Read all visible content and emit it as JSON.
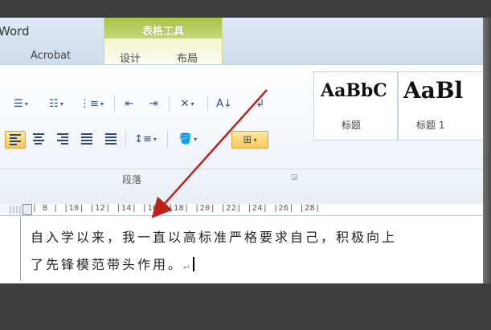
{
  "window": {
    "app_title": "Word",
    "context_tab_header": "表格工具",
    "tabs": [
      "Acrobat",
      "设计",
      "布局"
    ]
  },
  "ribbon": {
    "paragraph_group_label": "段落",
    "row1_buttons": [
      {
        "name": "bullets-button",
        "icon": "bullets-icon"
      },
      {
        "name": "numbering-button",
        "icon": "numbering-icon"
      },
      {
        "name": "multilevel-list-button",
        "icon": "multilevel-list-icon"
      },
      {
        "name": "decrease-indent-button",
        "icon": "decrease-indent-icon"
      },
      {
        "name": "increase-indent-button",
        "icon": "increase-indent-icon"
      },
      {
        "name": "chinese-layout-button",
        "icon": "chinese-layout-icon"
      },
      {
        "name": "sort-button",
        "icon": "sort-az-icon"
      },
      {
        "name": "show-marks-button",
        "icon": "pilcrow-icon"
      }
    ],
    "row2_buttons": [
      {
        "name": "align-left-button",
        "icon": "align-left-icon",
        "active": true
      },
      {
        "name": "align-center-button",
        "icon": "align-center-icon"
      },
      {
        "name": "align-right-button",
        "icon": "align-right-icon"
      },
      {
        "name": "justify-button",
        "icon": "justify-icon"
      },
      {
        "name": "distributed-button",
        "icon": "distributed-icon"
      },
      {
        "name": "line-spacing-button",
        "icon": "line-spacing-icon"
      },
      {
        "name": "shading-button",
        "icon": "shading-bucket-icon"
      },
      {
        "name": "borders-button",
        "icon": "borders-icon",
        "active": true
      }
    ],
    "styles": [
      {
        "preview": "AaBbC",
        "label": "标题"
      },
      {
        "preview": "AaBl",
        "label": "标题 1"
      }
    ]
  },
  "ruler": {
    "text": "| 8 |   |10|   |12|   |14|   |16|   |18|   |20|   |22|   |24|   |26|   |28|"
  },
  "document": {
    "line1": "自入学以来，我一直以高标准严格要求自己，积极向上",
    "line2": "了先锋模范带头作用。",
    "return_mark": "↵"
  },
  "colors": {
    "accent_active": "#f8c85a",
    "context_tab": "#a9c244",
    "annotation_arrow": "#c0201a"
  }
}
